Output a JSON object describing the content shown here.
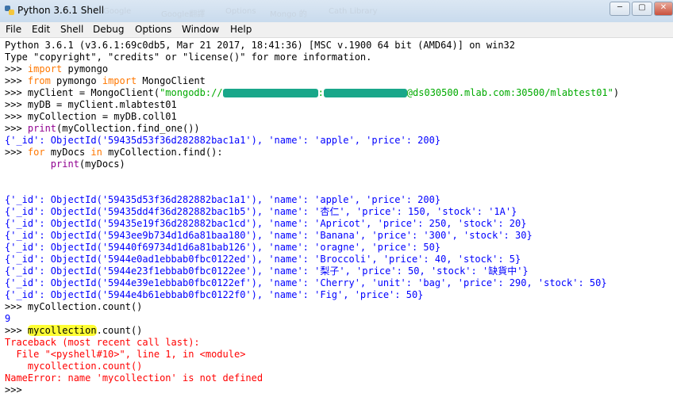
{
  "window": {
    "title": "Python 3.6.1 Shell",
    "ghost_tabs": [
      "Google",
      "Google翻譯",
      "Options",
      "Mongo 的",
      "Cath Library"
    ],
    "controls": [
      "─",
      "▢",
      "✕"
    ]
  },
  "menu": [
    "File",
    "Edit",
    "Shell",
    "Debug",
    "Options",
    "Window",
    "Help"
  ],
  "banner": [
    "Python 3.6.1 (v3.6.1:69c0db5, Mar 21 2017, 18:41:36) [MSC v.1900 64 bit (AMD64)] on win32",
    "Type \"copyright\", \"credits\" or \"license()\" for more information."
  ],
  "code": {
    "prompt": ">>> ",
    "l1_kw": "import",
    "l1_rest": " pymongo",
    "l2_kw1": "from",
    "l2_mid": " pymongo ",
    "l2_kw2": "import",
    "l2_rest": " MongoClient",
    "l3_a": "myClient = MongoClient(",
    "l3_s1": "\"mongodb://",
    "l3_s2": ":",
    "l3_s3": "@ds030500.mlab.com:30500/mlabtest01\"",
    "l3_z": ")",
    "l4": "myDB = myClient.mlabtest01",
    "l5": "myCollection = myDB.coll01",
    "l6_kw": "print",
    "l6_rest": "(myCollection.find_one())",
    "l7_out": "{'_id': ObjectId('59435d53f36d282882bac1a1'), 'name': 'apple', 'price': 200}",
    "l8_kw1": "for",
    "l8_mid": " myDocs ",
    "l8_kw2": "in",
    "l8_rest": " myCollection.find():",
    "l9_indent": "        ",
    "l9_kw": "print",
    "l9_rest": "(myDocs)"
  },
  "docs": [
    "{'_id': ObjectId('59435d53f36d282882bac1a1'), 'name': 'apple', 'price': 200}",
    "{'_id': ObjectId('59435dd4f36d282882bac1b5'), 'name': '杏仁', 'price': 150, 'stock': '1A'}",
    "{'_id': ObjectId('59435e19f36d282882bac1cd'), 'name': 'Apricot', 'price': 250, 'stock': 20}",
    "{'_id': ObjectId('5943ee9b734d1d6a81baa180'), 'name': 'Banana', 'price': '300', 'stock': 30}",
    "{'_id': ObjectId('59440f69734d1d6a81bab126'), 'name': 'oragne', 'price': 50}",
    "{'_id': ObjectId('5944e0ad1ebbab0fbc0122ed'), 'name': 'Broccoli', 'price': 40, 'stock': 5}",
    "{'_id': ObjectId('5944e23f1ebbab0fbc0122ee'), 'name': '梨子', 'price': 50, 'stock': '缺貨中'}",
    "{'_id': ObjectId('5944e39e1ebbab0fbc0122ef'), 'name': 'Cherry', 'unit': 'bag', 'price': 290, 'stock': 50}",
    "{'_id': ObjectId('5944e4b61ebbab0fbc0122f0'), 'name': 'Fig', 'price': 50}"
  ],
  "tail": {
    "count_cmd": "myCollection.count()",
    "count_out": "9",
    "bad_var": "mycollection",
    "bad_rest": ".count()",
    "tb1": "Traceback (most recent call last):",
    "tb2": "  File \"<pyshell#10>\", line 1, in <module>",
    "tb3": "    mycollection.count()",
    "tb4": "NameError: name 'mycollection' is not defined"
  },
  "colors": {
    "keyword": "#ff7700",
    "string": "#00aa00",
    "output": "#0000ff",
    "builtin": "#900090",
    "error": "#ff0000"
  }
}
